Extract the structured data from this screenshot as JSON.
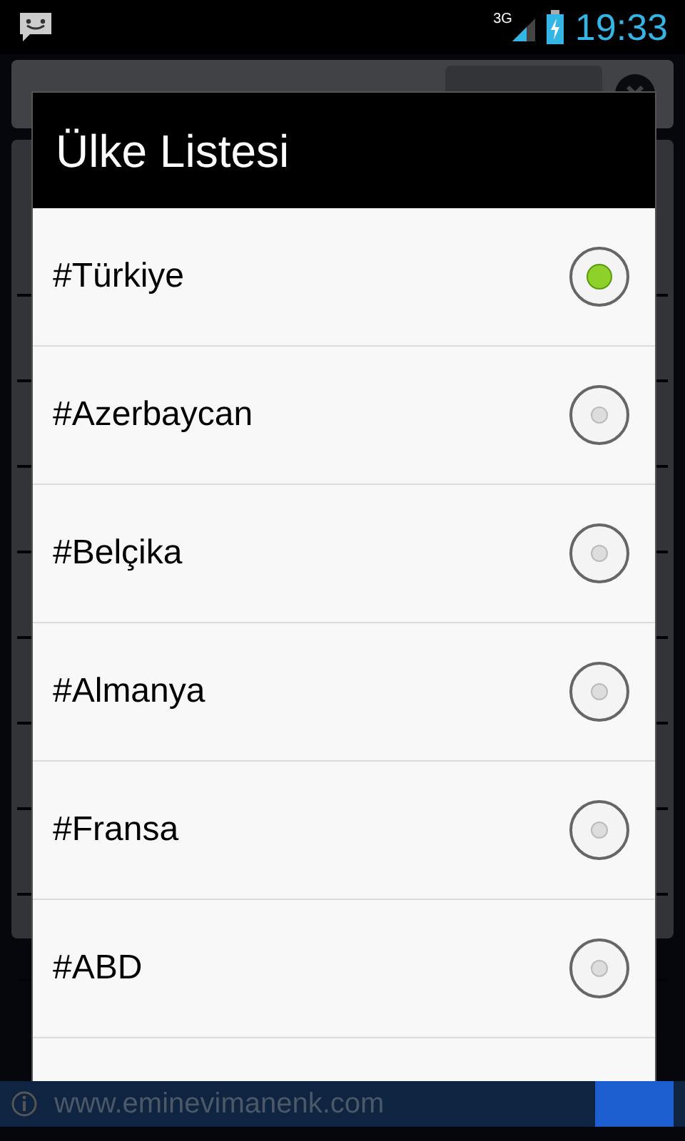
{
  "status_bar": {
    "network": "3G",
    "time": "19:33"
  },
  "dialog": {
    "title": "Ülke Listesi",
    "options": [
      {
        "label": "#Türkiye",
        "selected": true
      },
      {
        "label": "#Azerbaycan",
        "selected": false
      },
      {
        "label": "#Belçika",
        "selected": false
      },
      {
        "label": "#Almanya",
        "selected": false
      },
      {
        "label": "#Fransa",
        "selected": false
      },
      {
        "label": "#ABD",
        "selected": false
      }
    ]
  },
  "ad_banner": {
    "text": "www.eminevimanenk.com"
  }
}
